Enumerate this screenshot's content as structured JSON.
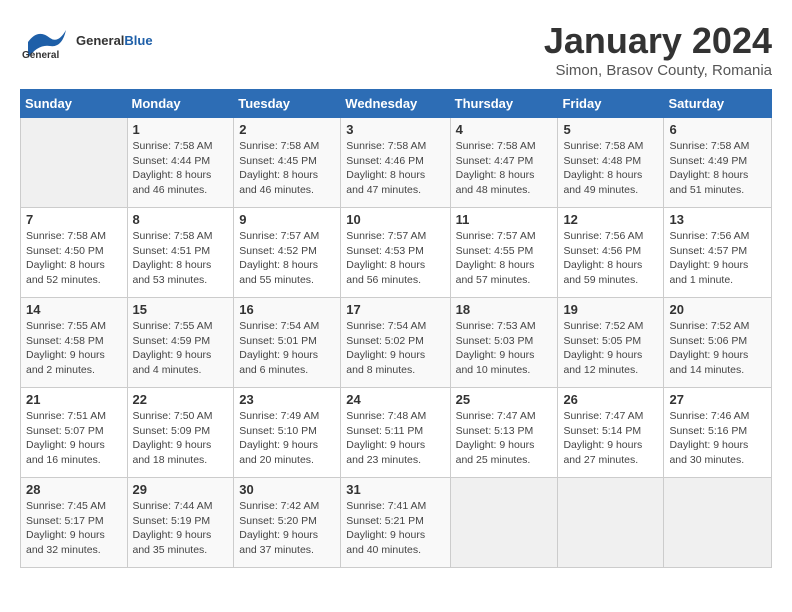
{
  "header": {
    "logo_general": "General",
    "logo_blue": "Blue",
    "title": "January 2024",
    "subtitle": "Simon, Brasov County, Romania"
  },
  "days_of_week": [
    "Sunday",
    "Monday",
    "Tuesday",
    "Wednesday",
    "Thursday",
    "Friday",
    "Saturday"
  ],
  "weeks": [
    [
      {
        "day": "",
        "info": ""
      },
      {
        "day": "1",
        "info": "Sunrise: 7:58 AM\nSunset: 4:44 PM\nDaylight: 8 hours\nand 46 minutes."
      },
      {
        "day": "2",
        "info": "Sunrise: 7:58 AM\nSunset: 4:45 PM\nDaylight: 8 hours\nand 46 minutes."
      },
      {
        "day": "3",
        "info": "Sunrise: 7:58 AM\nSunset: 4:46 PM\nDaylight: 8 hours\nand 47 minutes."
      },
      {
        "day": "4",
        "info": "Sunrise: 7:58 AM\nSunset: 4:47 PM\nDaylight: 8 hours\nand 48 minutes."
      },
      {
        "day": "5",
        "info": "Sunrise: 7:58 AM\nSunset: 4:48 PM\nDaylight: 8 hours\nand 49 minutes."
      },
      {
        "day": "6",
        "info": "Sunrise: 7:58 AM\nSunset: 4:49 PM\nDaylight: 8 hours\nand 51 minutes."
      }
    ],
    [
      {
        "day": "7",
        "info": "Sunrise: 7:58 AM\nSunset: 4:50 PM\nDaylight: 8 hours\nand 52 minutes."
      },
      {
        "day": "8",
        "info": "Sunrise: 7:58 AM\nSunset: 4:51 PM\nDaylight: 8 hours\nand 53 minutes."
      },
      {
        "day": "9",
        "info": "Sunrise: 7:57 AM\nSunset: 4:52 PM\nDaylight: 8 hours\nand 55 minutes."
      },
      {
        "day": "10",
        "info": "Sunrise: 7:57 AM\nSunset: 4:53 PM\nDaylight: 8 hours\nand 56 minutes."
      },
      {
        "day": "11",
        "info": "Sunrise: 7:57 AM\nSunset: 4:55 PM\nDaylight: 8 hours\nand 57 minutes."
      },
      {
        "day": "12",
        "info": "Sunrise: 7:56 AM\nSunset: 4:56 PM\nDaylight: 8 hours\nand 59 minutes."
      },
      {
        "day": "13",
        "info": "Sunrise: 7:56 AM\nSunset: 4:57 PM\nDaylight: 9 hours\nand 1 minute."
      }
    ],
    [
      {
        "day": "14",
        "info": "Sunrise: 7:55 AM\nSunset: 4:58 PM\nDaylight: 9 hours\nand 2 minutes."
      },
      {
        "day": "15",
        "info": "Sunrise: 7:55 AM\nSunset: 4:59 PM\nDaylight: 9 hours\nand 4 minutes."
      },
      {
        "day": "16",
        "info": "Sunrise: 7:54 AM\nSunset: 5:01 PM\nDaylight: 9 hours\nand 6 minutes."
      },
      {
        "day": "17",
        "info": "Sunrise: 7:54 AM\nSunset: 5:02 PM\nDaylight: 9 hours\nand 8 minutes."
      },
      {
        "day": "18",
        "info": "Sunrise: 7:53 AM\nSunset: 5:03 PM\nDaylight: 9 hours\nand 10 minutes."
      },
      {
        "day": "19",
        "info": "Sunrise: 7:52 AM\nSunset: 5:05 PM\nDaylight: 9 hours\nand 12 minutes."
      },
      {
        "day": "20",
        "info": "Sunrise: 7:52 AM\nSunset: 5:06 PM\nDaylight: 9 hours\nand 14 minutes."
      }
    ],
    [
      {
        "day": "21",
        "info": "Sunrise: 7:51 AM\nSunset: 5:07 PM\nDaylight: 9 hours\nand 16 minutes."
      },
      {
        "day": "22",
        "info": "Sunrise: 7:50 AM\nSunset: 5:09 PM\nDaylight: 9 hours\nand 18 minutes."
      },
      {
        "day": "23",
        "info": "Sunrise: 7:49 AM\nSunset: 5:10 PM\nDaylight: 9 hours\nand 20 minutes."
      },
      {
        "day": "24",
        "info": "Sunrise: 7:48 AM\nSunset: 5:11 PM\nDaylight: 9 hours\nand 23 minutes."
      },
      {
        "day": "25",
        "info": "Sunrise: 7:47 AM\nSunset: 5:13 PM\nDaylight: 9 hours\nand 25 minutes."
      },
      {
        "day": "26",
        "info": "Sunrise: 7:47 AM\nSunset: 5:14 PM\nDaylight: 9 hours\nand 27 minutes."
      },
      {
        "day": "27",
        "info": "Sunrise: 7:46 AM\nSunset: 5:16 PM\nDaylight: 9 hours\nand 30 minutes."
      }
    ],
    [
      {
        "day": "28",
        "info": "Sunrise: 7:45 AM\nSunset: 5:17 PM\nDaylight: 9 hours\nand 32 minutes."
      },
      {
        "day": "29",
        "info": "Sunrise: 7:44 AM\nSunset: 5:19 PM\nDaylight: 9 hours\nand 35 minutes."
      },
      {
        "day": "30",
        "info": "Sunrise: 7:42 AM\nSunset: 5:20 PM\nDaylight: 9 hours\nand 37 minutes."
      },
      {
        "day": "31",
        "info": "Sunrise: 7:41 AM\nSunset: 5:21 PM\nDaylight: 9 hours\nand 40 minutes."
      },
      {
        "day": "",
        "info": ""
      },
      {
        "day": "",
        "info": ""
      },
      {
        "day": "",
        "info": ""
      }
    ]
  ]
}
